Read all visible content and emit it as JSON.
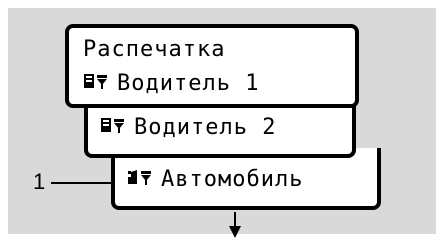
{
  "menu": {
    "title": "Распечатка",
    "items": [
      {
        "label": "Водитель 1",
        "icon": "driver-card-printer-icon"
      },
      {
        "label": "Водитель 2",
        "icon": "driver-card-printer-icon"
      },
      {
        "label": "Автомобиль",
        "icon": "vehicle-printer-icon"
      }
    ]
  },
  "callout": {
    "label": "1"
  },
  "colors": {
    "background": "#d9d9d9",
    "panel": "#ffffff",
    "ink": "#000000"
  }
}
